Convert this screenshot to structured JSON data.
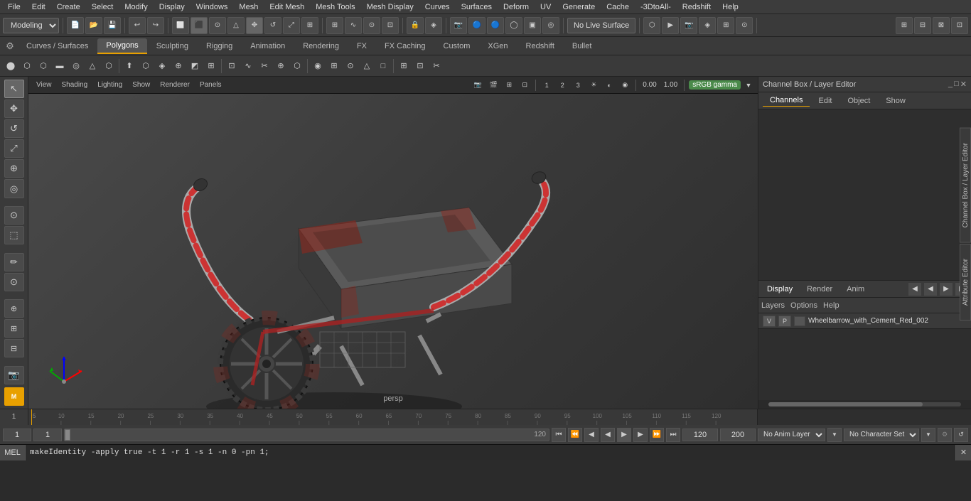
{
  "menubar": {
    "items": [
      "File",
      "Edit",
      "Create",
      "Select",
      "Modify",
      "Display",
      "Windows",
      "Mesh",
      "Edit Mesh",
      "Mesh Tools",
      "Mesh Display",
      "Curves",
      "Surfaces",
      "Deform",
      "UV",
      "Generate",
      "Cache",
      "-3DtoAll-",
      "Redshift",
      "Help"
    ]
  },
  "toolbar1": {
    "mode_selector": "Modeling",
    "live_surface_btn": "No Live Surface"
  },
  "tabs": {
    "items": [
      "Curves / Surfaces",
      "Polygons",
      "Sculpting",
      "Rigging",
      "Animation",
      "Rendering",
      "FX",
      "FX Caching",
      "Custom",
      "XGen",
      "Redshift",
      "Bullet"
    ],
    "active": "Polygons"
  },
  "viewport": {
    "menu_items": [
      "View",
      "Shading",
      "Lighting",
      "Show",
      "Renderer",
      "Panels"
    ],
    "persp_label": "persp",
    "coord_label": "0.00",
    "zoom_label": "1.00",
    "color_space": "sRGB gamma"
  },
  "channel_box": {
    "title": "Channel Box / Layer Editor",
    "tabs": [
      "Channels",
      "Edit",
      "Object",
      "Show"
    ],
    "display_tabs": [
      "Display",
      "Render",
      "Anim"
    ],
    "active_display_tab": "Display",
    "layer_tabs": [
      "Layers",
      "Options",
      "Help"
    ],
    "active_layer_tab": "Layers",
    "layer_row": {
      "v": "V",
      "p": "P",
      "name": "Wheelbarrow_with_Cement_Red_002"
    }
  },
  "timeline": {
    "ruler_marks": [
      "5",
      "10",
      "15",
      "20",
      "25",
      "30",
      "35",
      "40",
      "45",
      "50",
      "55",
      "60",
      "65",
      "70",
      "75",
      "80",
      "85",
      "90",
      "95",
      "100",
      "105",
      "110",
      "115",
      "120"
    ],
    "current_frame": "1"
  },
  "bottom_bar": {
    "frame1": "1",
    "frame2": "1",
    "slider_max": "120",
    "range_start": "120",
    "range_end": "200",
    "anim_layer": "No Anim Layer",
    "char_set": "No Character Set"
  },
  "command_line": {
    "lang": "MEL",
    "command": "makeIdentity -apply true -t 1 -r 1 -s 1 -n 0 -pn 1;"
  },
  "window_controls": {
    "minimize": "_",
    "maximize": "□",
    "close": "✕"
  }
}
